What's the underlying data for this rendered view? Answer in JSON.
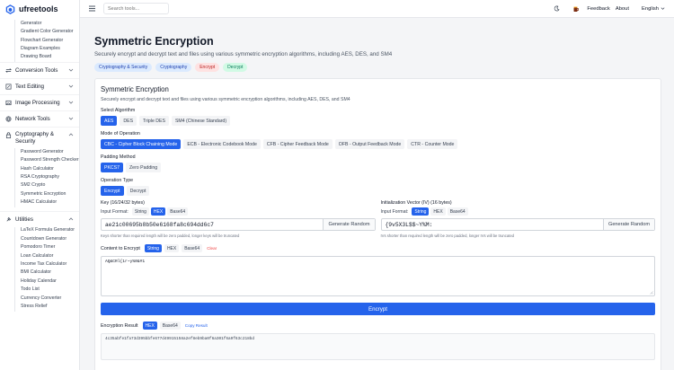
{
  "app": {
    "name": "ufreetools"
  },
  "topbar": {
    "search_placeholder": "Search tools...",
    "feedback": "Feedback",
    "about": "About",
    "language": "English"
  },
  "sidebar": {
    "top_items": [
      "Generator",
      "Gradient Color Generator",
      "Flowchart Generator",
      "Diagram Examples",
      "Drawing Board"
    ],
    "groups": [
      {
        "label": "Conversion Tools",
        "icon": "conversion-icon"
      },
      {
        "label": "Text Editing",
        "icon": "text-edit-icon"
      },
      {
        "label": "Image Processing",
        "icon": "image-icon"
      },
      {
        "label": "Network Tools",
        "icon": "network-icon"
      }
    ],
    "crypto_group": {
      "label": "Cryptography & Security",
      "icon": "lock-icon"
    },
    "crypto_items": [
      "Password Generator",
      "Password Strength Checker",
      "Hash Calculator",
      "RSA Cryptography",
      "SM2 Crypto",
      "Symmetric Encryption",
      "HMAC Calculator"
    ],
    "utilities_group": {
      "label": "Utilities",
      "icon": "utilities-icon"
    },
    "utilities_items": [
      "LaTeX Formula Generator",
      "Countdown Generator",
      "Pomodoro Timer",
      "Loan Calculator",
      "Income Tax Calculator",
      "BMI Calculator",
      "Holiday Calendar",
      "Todo List",
      "Currency Converter",
      "Stress Relief"
    ]
  },
  "page": {
    "title": "Symmetric Encryption",
    "description": "Securely encrypt and decrypt text and files using various symmetric encryption algorithms, including AES, DES, and SM4",
    "tags": [
      "Cryptography & Security",
      "Cryptography",
      "Encrypt",
      "Decrypt"
    ]
  },
  "card": {
    "title": "Symmetric Encryption",
    "description": "Securely encrypt and decrypt text and files using various symmetric encryption algorithms, including AES, DES, and SM4",
    "algorithm_label": "Select Algorithm",
    "algorithms": [
      "AES",
      "DES",
      "Triple DES",
      "SM4 (Chinese Standard)"
    ],
    "mode_label": "Mode of Operation",
    "modes": [
      "CBC - Cipher Block Chaining Mode",
      "ECB - Electronic Codebook Mode",
      "CFB - Cipher Feedback Mode",
      "OFB - Output Feedback Mode",
      "CTR - Counter Mode"
    ],
    "padding_label": "Padding Method",
    "paddings": [
      "PKCS7",
      "Zero Padding"
    ],
    "operation_label": "Operation Type",
    "operations": [
      "Encrypt",
      "Decrypt"
    ],
    "key": {
      "label": "Key (16/24/32 bytes)",
      "format_label": "Input Format:",
      "formats": [
        "String",
        "HEX",
        "Base64"
      ],
      "value": "ae21c00695b8b50e6168fa8c694dd6c7",
      "generate": "Generate Random",
      "hint": "Keys shorter than required length will be zero padded, longer keys will be truncated"
    },
    "iv": {
      "label": "Initialization Vector (IV) (16 bytes)",
      "format_label": "Input Format:",
      "formats": [
        "String",
        "HEX",
        "Base64"
      ],
      "value": "{9v5X3L$$~Y%M:",
      "generate": "Generate Random",
      "hint": "IVs shorter than required length will be zero padded, longer IVs will be truncated"
    },
    "content": {
      "label": "Content to Encrypt",
      "formats": [
        "String",
        "HEX",
        "Base64"
      ],
      "clear": "Clear",
      "value": "AQ&CRl{1r~y%0&#1"
    },
    "encrypt_button": "Encrypt",
    "result": {
      "label": "Encryption Result",
      "formats": [
        "HEX",
        "Base64"
      ],
      "copy": "Copy Result",
      "value": "4c35abfe1fa73d395bbfe677d49915158a2ef8eb9ba0f6a301f6a9f63c218bd"
    }
  },
  "colors": {
    "accent": "#2563eb",
    "danger": "#ef4444"
  }
}
